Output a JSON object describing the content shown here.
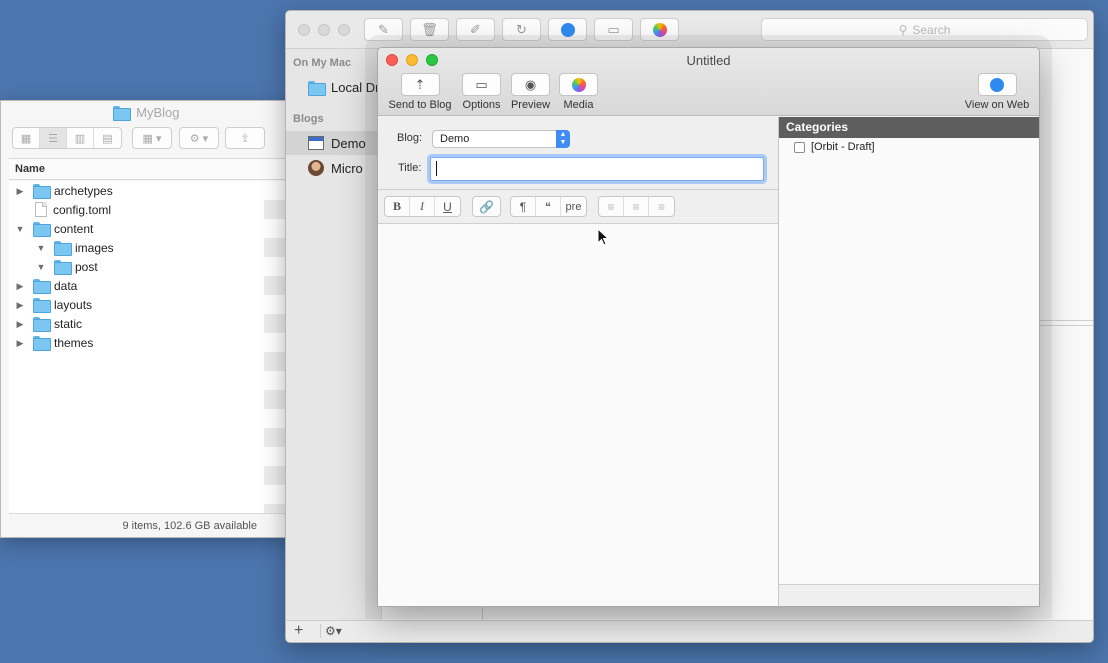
{
  "finder": {
    "title": "MyBlog",
    "column_name": "Name",
    "items": [
      {
        "name": "archetypes",
        "kind": "folder",
        "indent": 0,
        "disclosure": "▶"
      },
      {
        "name": "config.toml",
        "kind": "file",
        "indent": 0,
        "disclosure": ""
      },
      {
        "name": "content",
        "kind": "folder",
        "indent": 0,
        "disclosure": "▼"
      },
      {
        "name": "images",
        "kind": "folder",
        "indent": 1,
        "disclosure": "▼"
      },
      {
        "name": "post",
        "kind": "folder",
        "indent": 1,
        "disclosure": "▼"
      },
      {
        "name": "data",
        "kind": "folder",
        "indent": 0,
        "disclosure": "▶"
      },
      {
        "name": "layouts",
        "kind": "folder",
        "indent": 0,
        "disclosure": "▶"
      },
      {
        "name": "static",
        "kind": "folder",
        "indent": 0,
        "disclosure": "▶"
      },
      {
        "name": "themes",
        "kind": "folder",
        "indent": 0,
        "disclosure": "▶"
      }
    ],
    "status": "9 items, 102.6 GB available"
  },
  "main_window": {
    "search_placeholder": "Search",
    "sidebar": {
      "section_mac": "On My Mac",
      "local_drafts": "Local Dr",
      "section_blogs": "Blogs",
      "blogs": [
        "Demo",
        "Micro"
      ]
    }
  },
  "post_window": {
    "title": "Untitled",
    "toolbar": {
      "send": "Send to Blog",
      "options": "Options",
      "preview": "Preview",
      "media": "Media",
      "view_web": "View on Web"
    },
    "blog_label": "Blog:",
    "blog_value": "Demo",
    "title_label": "Title:",
    "title_value": "",
    "format": {
      "bold": "B",
      "italic": "I",
      "underline": "U",
      "paragraph": "¶",
      "quote": "“",
      "pre": "pre"
    },
    "categories_header": "Categories",
    "categories": [
      "[Orbit - Draft]"
    ]
  },
  "colors": {
    "desktop": "#4b75ad",
    "accent": "#3d8df5",
    "categories_header_bg": "#5e5e5e",
    "folder_blue": "#7cc6f2"
  }
}
